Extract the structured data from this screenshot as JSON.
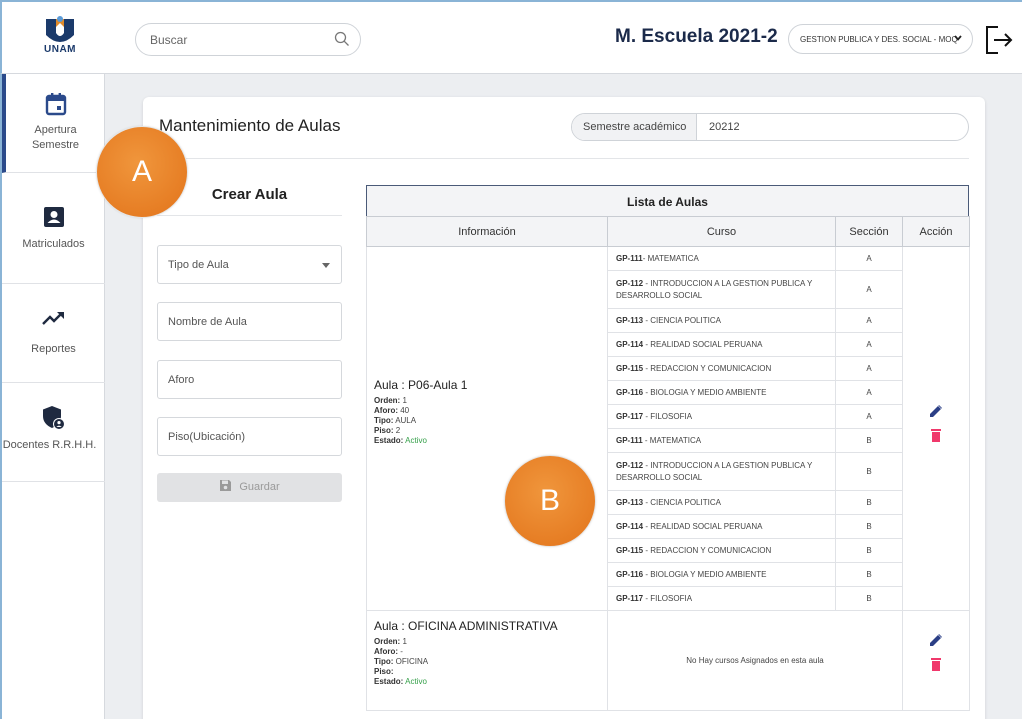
{
  "header": {
    "logo_text": "UNAM",
    "search_placeholder": "Buscar",
    "app_title": "M. Escuela 2021-2",
    "school_selected": "GESTION PUBLICA Y DES. SOCIAL - MOQ"
  },
  "sidebar": {
    "items": [
      {
        "label": "Apertura Semestre",
        "icon": "calendar-icon",
        "active": true
      },
      {
        "label": "Matriculados",
        "icon": "contact-card-icon",
        "active": false
      },
      {
        "label": "Reportes",
        "icon": "trending-up-icon",
        "active": false
      },
      {
        "label": "Docentes R.R.H.H.",
        "icon": "shield-user-icon",
        "active": false
      }
    ]
  },
  "page": {
    "title": "Mantenimiento de Aulas",
    "semester_label": "Semestre académico",
    "semester_value": "20212"
  },
  "form": {
    "title": "Crear Aula",
    "tipo_placeholder": "Tipo de Aula",
    "nombre_placeholder": "Nombre de Aula",
    "aforo_placeholder": "Aforo",
    "piso_placeholder": "Piso(Ubicación)",
    "save_label": "Guardar"
  },
  "table": {
    "title": "Lista de Aulas",
    "headers": {
      "info": "Información",
      "curso": "Curso",
      "seccion": "Sección",
      "accion": "Acción"
    },
    "aulas": [
      {
        "name": "Aula : P06-Aula 1",
        "orden_label": "Orden:",
        "orden": "1",
        "aforo_label": "Aforo:",
        "aforo": "40",
        "tipo_label": "Tipo:",
        "tipo": "AULA",
        "piso_label": "Piso:",
        "piso": "2",
        "estado_label": "Estado:",
        "estado": "Activo",
        "courses": [
          {
            "code": "GP-111",
            "name": "- MATEMATICA",
            "sec": "A"
          },
          {
            "code": "GP-112",
            "name": " - INTRODUCCION A LA GESTION PUBLICA Y DESARROLLO SOCIAL",
            "sec": "A"
          },
          {
            "code": "GP-113",
            "name": " - CIENCIA POLITICA",
            "sec": "A"
          },
          {
            "code": "GP-114",
            "name": " - REALIDAD SOCIAL PERUANA",
            "sec": "A"
          },
          {
            "code": "GP-115",
            "name": " - REDACCION Y COMUNICACION",
            "sec": "A"
          },
          {
            "code": "GP-116",
            "name": " - BIOLOGIA Y MEDIO AMBIENTE",
            "sec": "A"
          },
          {
            "code": "GP-117",
            "name": " - FILOSOFIA",
            "sec": "A"
          },
          {
            "code": "GP-111",
            "name": " - MATEMATICA",
            "sec": "B"
          },
          {
            "code": "GP-112",
            "name": " - INTRODUCCION A LA GESTION PUBLICA Y DESARROLLO SOCIAL",
            "sec": "B"
          },
          {
            "code": "GP-113",
            "name": " - CIENCIA POLITICA",
            "sec": "B"
          },
          {
            "code": "GP-114",
            "name": " - REALIDAD SOCIAL PERUANA",
            "sec": "B"
          },
          {
            "code": "GP-115",
            "name": " - REDACCION Y COMUNICACION",
            "sec": "B"
          },
          {
            "code": "GP-116",
            "name": " - BIOLOGIA Y MEDIO AMBIENTE",
            "sec": "B"
          },
          {
            "code": "GP-117",
            "name": " - FILOSOFIA",
            "sec": "B"
          }
        ]
      },
      {
        "name": "Aula : OFICINA ADMINISTRATIVA",
        "orden_label": "Orden:",
        "orden": "1",
        "aforo_label": "Aforo:",
        "aforo": "-",
        "tipo_label": "Tipo:",
        "tipo": "OFICINA",
        "piso_label": "Piso:",
        "piso": "",
        "estado_label": "Estado:",
        "estado": "Activo",
        "empty_message": "No Hay cursos Asignados en esta aula"
      }
    ]
  },
  "callouts": {
    "a": "A",
    "b": "B"
  },
  "colors": {
    "accent": "#2b4a8b",
    "edit": "#2b3f86",
    "delete": "#f0386b",
    "active_status": "#35a04a",
    "callout": "#e8821f"
  }
}
